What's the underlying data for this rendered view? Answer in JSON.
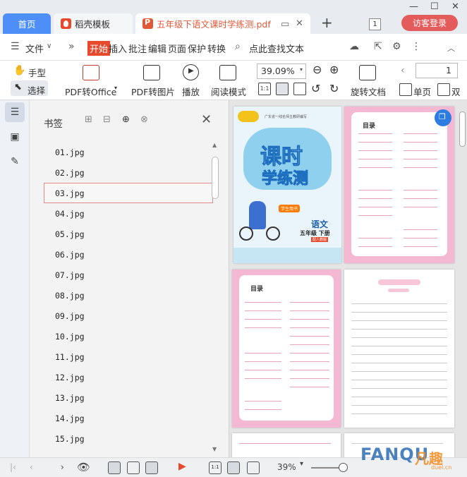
{
  "tabs": {
    "home": "首页",
    "templates": "稻壳模板",
    "document": "五年级下语文课时学练测.pdf"
  },
  "window": {
    "page_count_badge": "1",
    "login": "访客登录"
  },
  "menu": {
    "file": "文件",
    "items": [
      "开始",
      "插入",
      "批注",
      "编辑",
      "页面",
      "保护",
      "转换"
    ],
    "search": "点此查找文本"
  },
  "toolbar": {
    "hand": "手型",
    "select": "选择",
    "pdf_to_office": "PDF转Office",
    "pdf_to_image": "PDF转图片",
    "play": "播放",
    "read_mode": "阅读模式",
    "zoom": "39.09%",
    "rotate": "旋转文档",
    "single_page": "单页",
    "double_page": "双",
    "page_number": "1"
  },
  "bookmarks": {
    "title": "书签",
    "items": [
      "01.jpg",
      "02.jpg",
      "03.jpg",
      "04.jpg",
      "05.jpg",
      "06.jpg",
      "07.jpg",
      "08.jpg",
      "09.jpg",
      "10.jpg",
      "11.jpg",
      "12.jpg",
      "13.jpg",
      "14.jpg",
      "15.jpg"
    ],
    "selected_index": 2
  },
  "cover": {
    "top_text": "广东省一线名师主教研编写",
    "title_1": "课时",
    "title_2": "学练测",
    "badge": "学生用书",
    "subject": "语文",
    "grade": "五年级 下册",
    "edition": "配人教版"
  },
  "toc": {
    "title": "目录"
  },
  "status": {
    "zoom": "39%"
  },
  "watermark": {
    "brand_a": "FANQU",
    "brand_b": "凡趣",
    "sub": "duel.cn"
  },
  "colors": {
    "accent": "#4e8ef7",
    "active_tab": "#e8492d",
    "login": "#e45b5b",
    "toc_pink": "#f5b8d3"
  }
}
